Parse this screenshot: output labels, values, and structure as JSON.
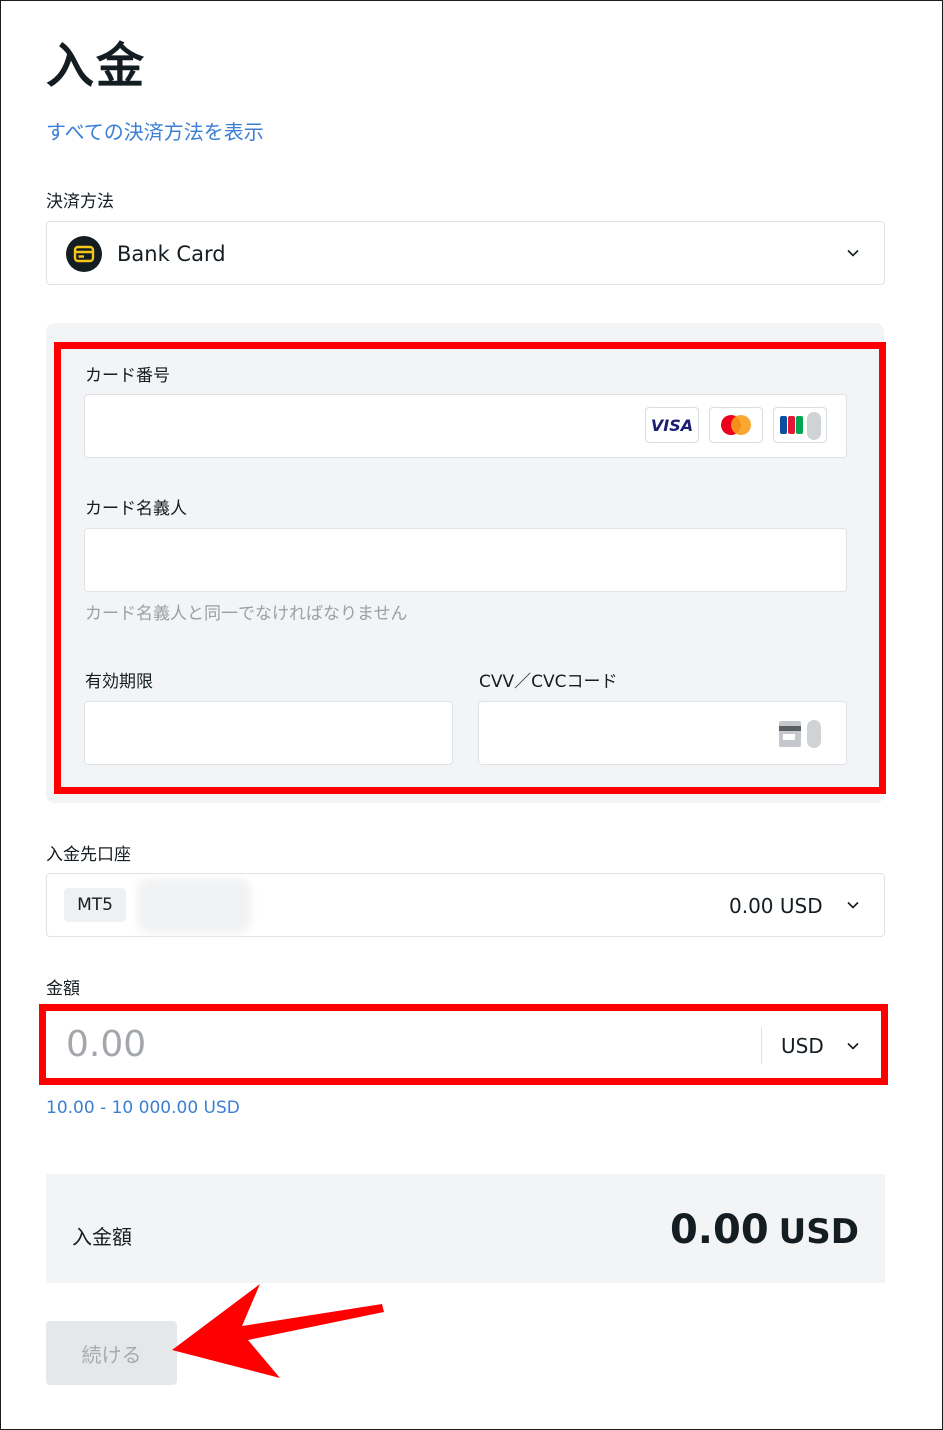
{
  "page": {
    "title": "入金",
    "show_all_methods_link": "すべての決済方法を表示"
  },
  "payment_method": {
    "label": "決済方法",
    "selected": "Bank Card",
    "icon": "card-icon"
  },
  "card_form": {
    "card_number_label": "カード番号",
    "card_brands": [
      "VISA",
      "mastercard",
      "JCB"
    ],
    "cardholder_label": "カード名義人",
    "cardholder_hint": "カード名義人と同一でなければなりません",
    "expiry_label": "有効期限",
    "cvv_label": "CVV／CVCコード"
  },
  "account": {
    "label": "入金先口座",
    "type_badge": "MT5",
    "balance": "0.00 USD"
  },
  "amount": {
    "label": "金額",
    "placeholder": "0.00",
    "currency": "USD",
    "range": "10.00 - 10 000.00 USD"
  },
  "summary": {
    "label": "入金額",
    "value": "0.00",
    "currency": "USD"
  },
  "actions": {
    "continue_label": "続ける"
  },
  "colors": {
    "accent": "#3b7fd4",
    "highlight": "#ff0000",
    "panel": "#f3f4f6"
  }
}
